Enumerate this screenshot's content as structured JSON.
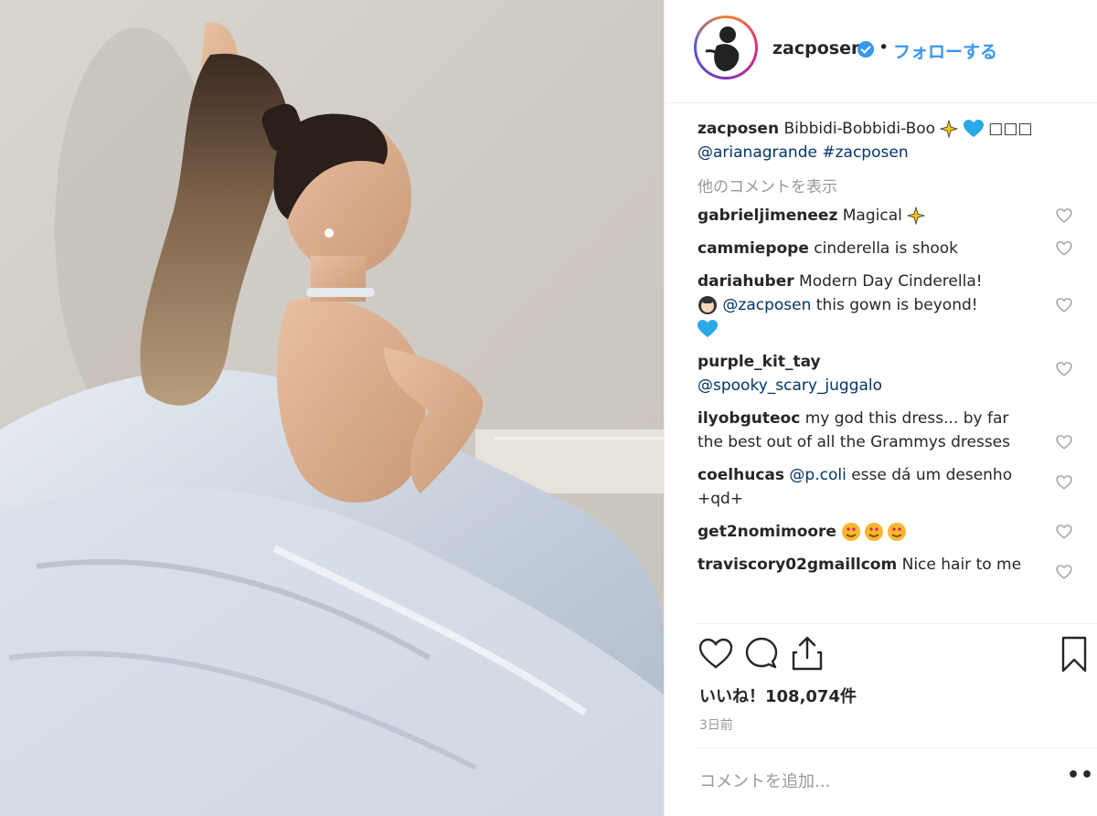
{
  "header": {
    "username": "zacposen",
    "separator": "•",
    "follow_label": "フォローする"
  },
  "caption": {
    "username": "zacposen",
    "text": "Bibbidi-Bobbidi-Boo",
    "trail": "□□□",
    "mention": "@arianagrande",
    "hashtag": "#zacposen"
  },
  "load_more": "他のコメントを表示",
  "comments": [
    {
      "user": "gabrieljimeneez",
      "text": "Magical"
    },
    {
      "user": "cammiepope",
      "text": "cinderella is shook"
    },
    {
      "user": "dariahuber",
      "text": "Modern Day Cinderella!",
      "mention": "@zacposen",
      "text2": "this gown is beyond!"
    },
    {
      "user": "purple_kit_tay",
      "mention": "@spooky_scary_juggalo"
    },
    {
      "user": "ilyobguteoc",
      "text": "my god this dress... by far the best out of all the Grammys dresses"
    },
    {
      "user": "coelhucas",
      "mention": "@p.coli",
      "text": "esse dá um desenho +qd+"
    },
    {
      "user": "get2nomimoore"
    },
    {
      "user": "traviscory02gmaillcom",
      "text": "Nice hair to me"
    }
  ],
  "likes": {
    "label": "いいね！",
    "count": "108,074件"
  },
  "date": "3日前",
  "add_comment": {
    "placeholder": "コメントを追加..."
  },
  "more_label": "•••",
  "icons": {
    "like": "heart-icon",
    "comment": "comment-icon",
    "share": "share-icon",
    "save": "bookmark-icon",
    "verified": "verified-badge-icon"
  },
  "colors": {
    "link": "#003569",
    "follow": "#3897f0",
    "verified": "#3897f0",
    "muted": "#999999"
  }
}
